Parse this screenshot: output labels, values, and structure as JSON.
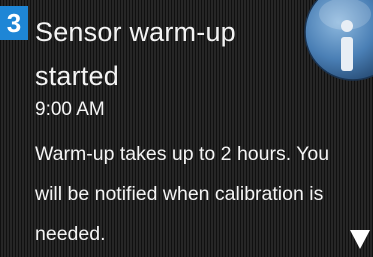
{
  "notification": {
    "step": "3",
    "title": "Sensor warm-up started",
    "time": "9:00 AM",
    "message": "Warm-up takes up to 2 hours. You will be notified when calibration is needed.",
    "icon": "info-icon",
    "scroll_icon": "scroll-down-arrow-icon"
  },
  "colors": {
    "badge": "#1e86d6",
    "background": "#1c1c1c",
    "text": "#f4f4f4",
    "info_icon": "#4a7fb5"
  }
}
